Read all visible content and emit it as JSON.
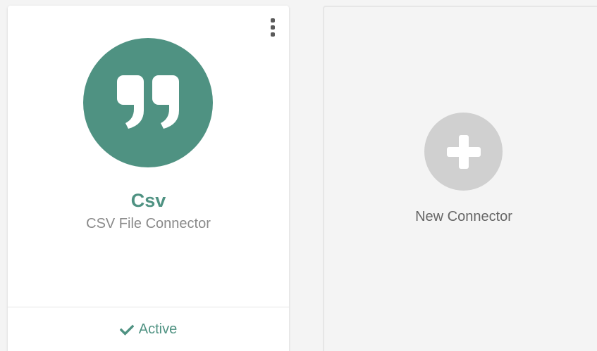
{
  "connectors": [
    {
      "name": "Csv",
      "description": "CSV File Connector",
      "icon": "quote-icon",
      "status": "Active",
      "status_icon": "check-icon",
      "menu_icon": "more-vertical-icon"
    }
  ],
  "new_connector": {
    "label": "New Connector",
    "icon": "plus-icon"
  },
  "colors": {
    "brand": "#4f9282",
    "page_background": "#f4f4f4",
    "card_background": "#ffffff",
    "add_circle": "#d0d0d0",
    "description_text": "#8a8a8a"
  }
}
